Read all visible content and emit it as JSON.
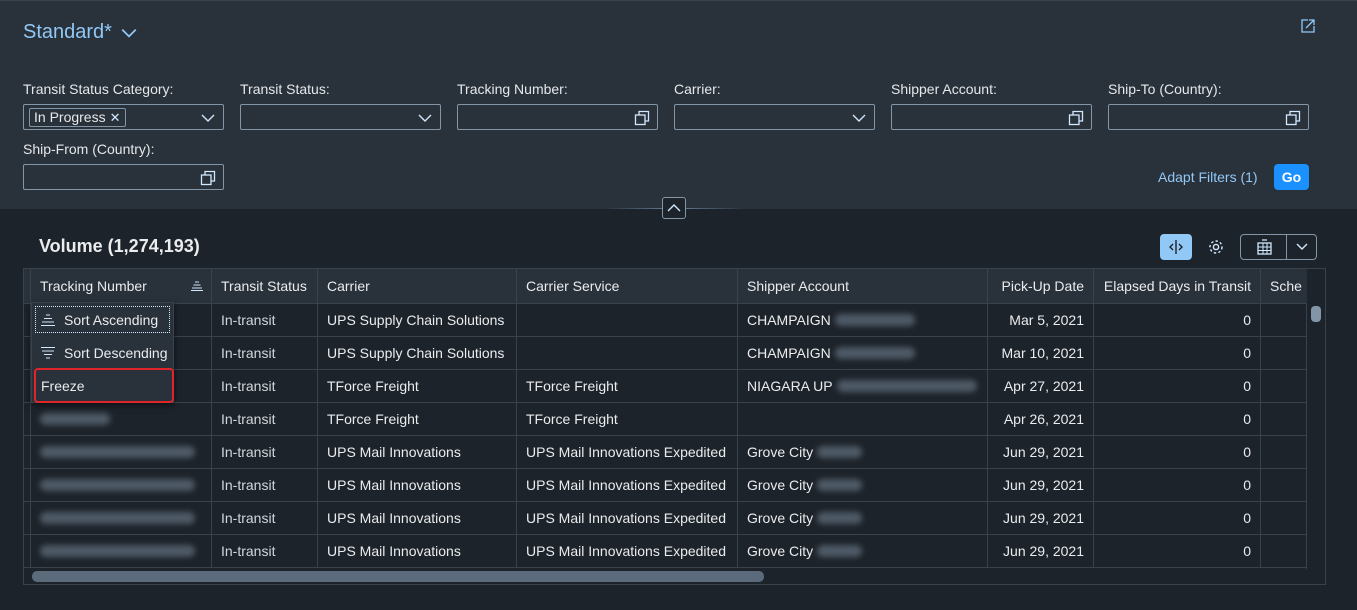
{
  "variant": {
    "title": "Standard*"
  },
  "filters": [
    {
      "label": "Transit Status Category:",
      "type": "multicombo",
      "tokens": [
        "In Progress"
      ],
      "value": ""
    },
    {
      "label": "Transit Status:",
      "type": "combo",
      "value": ""
    },
    {
      "label": "Tracking Number:",
      "type": "valuehelp",
      "value": ""
    },
    {
      "label": "Carrier:",
      "type": "combo",
      "value": ""
    },
    {
      "label": "Shipper Account:",
      "type": "valuehelp",
      "value": ""
    },
    {
      "label": "Ship-To (Country):",
      "type": "valuehelp",
      "value": ""
    },
    {
      "label": "Ship-From (Country):",
      "type": "valuehelp",
      "value": ""
    }
  ],
  "filterbar": {
    "adapt_label": "Adapt Filters (1)",
    "go_label": "Go"
  },
  "table": {
    "title": "Volume (1,274,193)",
    "columns": [
      "Tracking Number",
      "Transit Status",
      "Carrier",
      "Carrier Service",
      "Shipper Account",
      "Pick-Up Date",
      "Elapsed Days in Transit",
      "Sche"
    ],
    "rows": [
      {
        "tracking": "",
        "status": "In-transit",
        "carrier": "UPS Supply Chain Solutions",
        "service": "",
        "shipper": "CHAMPAIGN",
        "pickup": "Mar 5, 2021",
        "elapsed": "0"
      },
      {
        "tracking": "",
        "status": "In-transit",
        "carrier": "UPS Supply Chain Solutions",
        "service": "",
        "shipper": "CHAMPAIGN",
        "pickup": "Mar 10, 2021",
        "elapsed": "0"
      },
      {
        "tracking": "",
        "status": "In-transit",
        "carrier": "TForce Freight",
        "service": "TForce Freight",
        "shipper": "NIAGARA UP",
        "pickup": "Apr 27, 2021",
        "elapsed": "0"
      },
      {
        "tracking": "",
        "status": "In-transit",
        "carrier": "TForce Freight",
        "service": "TForce Freight",
        "shipper": "",
        "pickup": "Apr 26, 2021",
        "elapsed": "0"
      },
      {
        "tracking": "",
        "status": "In-transit",
        "carrier": "UPS Mail Innovations",
        "service": "UPS Mail Innovations Expedited",
        "shipper": "Grove City",
        "pickup": "Jun 29, 2021",
        "elapsed": "0"
      },
      {
        "tracking": "",
        "status": "In-transit",
        "carrier": "UPS Mail Innovations",
        "service": "UPS Mail Innovations Expedited",
        "shipper": "Grove City",
        "pickup": "Jun 29, 2021",
        "elapsed": "0"
      },
      {
        "tracking": "",
        "status": "In-transit",
        "carrier": "UPS Mail Innovations",
        "service": "UPS Mail Innovations Expedited",
        "shipper": "Grove City",
        "pickup": "Jun 29, 2021",
        "elapsed": "0"
      },
      {
        "tracking": "",
        "status": "In-transit",
        "carrier": "UPS Mail Innovations",
        "service": "UPS Mail Innovations Expedited",
        "shipper": "Grove City",
        "pickup": "Jun 29, 2021",
        "elapsed": "0"
      }
    ]
  },
  "column_menu": {
    "items": [
      "Sort Ascending",
      "Sort Descending",
      "Freeze"
    ]
  },
  "colors": {
    "accent": "#1b90ff",
    "link": "#91c8f6",
    "highlight": "#e0242b",
    "background": "#1d232a",
    "header": "#29313a"
  }
}
